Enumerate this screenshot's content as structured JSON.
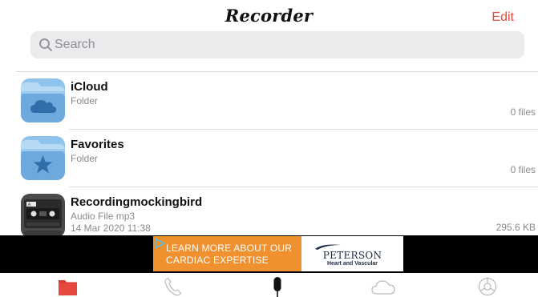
{
  "app": {
    "title": "Recorder",
    "edit_label": "Edit"
  },
  "search": {
    "placeholder": "Search",
    "value": ""
  },
  "items": [
    {
      "title": "iCloud",
      "subtitle": "Folder",
      "subtitle2": "",
      "meta": "0 files",
      "icon": "icloud-folder-icon"
    },
    {
      "title": "Favorites",
      "subtitle": "Folder",
      "subtitle2": "",
      "meta": "0 files",
      "icon": "favorites-folder-icon"
    },
    {
      "title": "Recordingmockingbird",
      "subtitle": "Audio File mp3",
      "subtitle2": "14 Mar 2020 11:38",
      "meta": "295.6 KB",
      "icon": "cassette-icon"
    }
  ],
  "ad": {
    "line1": "LEARN MORE ABOUT OUR",
    "line2": "CARDIAC EXPERTISE",
    "brand": "PETERSON",
    "brand_sub": "Heart and Vascular"
  },
  "tabs": [
    {
      "name": "files",
      "icon": "folder-icon",
      "active": true
    },
    {
      "name": "calls",
      "icon": "phone-icon",
      "active": false
    },
    {
      "name": "record",
      "icon": "microphone-icon",
      "active": false
    },
    {
      "name": "cloud",
      "icon": "cloud-icon",
      "active": false
    },
    {
      "name": "settings",
      "icon": "gear-icon",
      "active": false
    }
  ],
  "colors": {
    "accent": "#e5483e",
    "folder_blue": "#8fc3ec",
    "ad_orange": "#f0902f"
  }
}
